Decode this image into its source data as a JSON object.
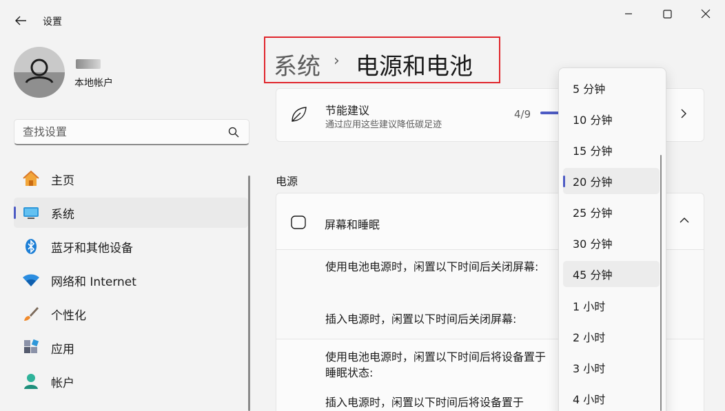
{
  "window": {
    "title": "设置"
  },
  "profile": {
    "account_type": "本地帐户"
  },
  "search": {
    "placeholder": "查找设置"
  },
  "sidebar": {
    "items": [
      {
        "label": "主页",
        "icon": "home-icon"
      },
      {
        "label": "系统",
        "icon": "system-icon",
        "active": true
      },
      {
        "label": "蓝牙和其他设备",
        "icon": "bluetooth-icon"
      },
      {
        "label": "网络和 Internet",
        "icon": "wifi-icon"
      },
      {
        "label": "个性化",
        "icon": "brush-icon"
      },
      {
        "label": "应用",
        "icon": "apps-icon"
      },
      {
        "label": "帐户",
        "icon": "account-icon"
      }
    ]
  },
  "breadcrumb": {
    "parent": "系统",
    "separator": "›",
    "current": "电源和电池"
  },
  "eco": {
    "title": "节能建议",
    "subtitle": "通过应用这些建议降低碳足迹",
    "progress_text": "4/9",
    "progress_fraction": 0.444
  },
  "power_section": {
    "label": "电源"
  },
  "screen_sleep": {
    "title": "屏幕和睡眠",
    "options": [
      "使用电池电源时，闲置以下时间后关闭屏幕:",
      "插入电源时，闲置以下时间后关闭屏幕:",
      "使用电池电源时，闲置以下时间后将设备置于睡眠状态:",
      "插入电源时，闲置以下时间后将设备置于"
    ]
  },
  "dropdown": {
    "options": [
      "5 分钟",
      "10 分钟",
      "15 分钟",
      "20 分钟",
      "25 分钟",
      "30 分钟",
      "45 分钟",
      "1 小时",
      "2 小时",
      "3 小时",
      "4 小时"
    ],
    "selected": "20 分钟",
    "hovered": "45 分钟"
  },
  "colors": {
    "accent": "#4d5bc4",
    "highlight_box": "#e0252b"
  }
}
